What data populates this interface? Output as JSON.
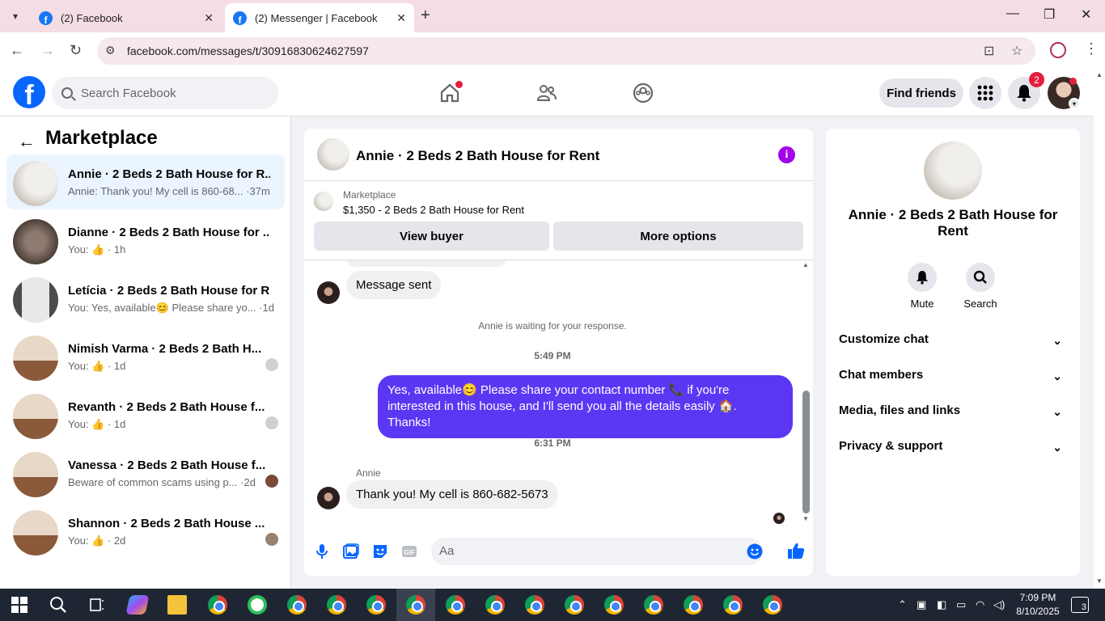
{
  "browser": {
    "tabs": [
      {
        "label": "(2) Facebook",
        "active": false
      },
      {
        "label": "(2) Messenger | Facebook",
        "active": true
      }
    ],
    "url": "facebook.com/messages/t/30916830624627597"
  },
  "fb": {
    "search_placeholder": "Search Facebook",
    "find_friends": "Find friends",
    "notif_count": "2",
    "brand_color": "#0866ff"
  },
  "left": {
    "title": "Marketplace",
    "conversations": [
      {
        "name": "Annie · 2 Beds 2 Bath House for R...",
        "snippet": "Annie: Thank you! My cell is 860-68... ·37m",
        "active": true
      },
      {
        "name": "Dianne · 2 Beds 2 Bath House for ...",
        "snippet": "You: 👍 · 1h"
      },
      {
        "name": "Letícia · 2 Beds 2 Bath House for R...",
        "snippet": "You: Yes, available😊 Please share yo... ·1d"
      },
      {
        "name": "Nimish Varma · 2 Beds 2 Bath H...",
        "snippet": "You: 👍 · 1d"
      },
      {
        "name": "Revanth · 2 Beds 2 Bath House f...",
        "snippet": "You: 👍 · 1d"
      },
      {
        "name": "Vanessa · 2 Beds 2 Bath House f...",
        "snippet": "Beware of common scams using p... ·2d"
      },
      {
        "name": "Shannon · 2 Beds 2 Bath House ...",
        "snippet": "You: 👍 · 2d"
      }
    ]
  },
  "chat": {
    "title": "Annie · 2 Beds 2 Bath House for Rent",
    "marketplace_label": "Marketplace",
    "listing": "$1,350 - 2 Beds 2 Bath House for Rent",
    "view_buyer": "View buyer",
    "more_options": "More options",
    "messages": {
      "message_sent": "Message sent",
      "waiting": "Annie is waiting for your response.",
      "time1": "5:49 PM",
      "outgoing": "Yes, available😊 Please share your contact number 📞 if you're interested in this house, and I'll send you all the details easily 🏠. Thanks!",
      "time2": "6:31 PM",
      "sender": "Annie",
      "incoming": "Thank you! My cell is 860-682-5673"
    },
    "composer_placeholder": "Aa",
    "accent": "#5b37f4"
  },
  "right": {
    "title": "Annie · 2 Beds 2 Bath House for Rent",
    "mute": "Mute",
    "search": "Search",
    "rows": [
      "Customize chat",
      "Chat members",
      "Media, files and links",
      "Privacy & support"
    ]
  },
  "taskbar": {
    "time": "7:09 PM",
    "date": "8/10/2025",
    "notif": "3"
  }
}
